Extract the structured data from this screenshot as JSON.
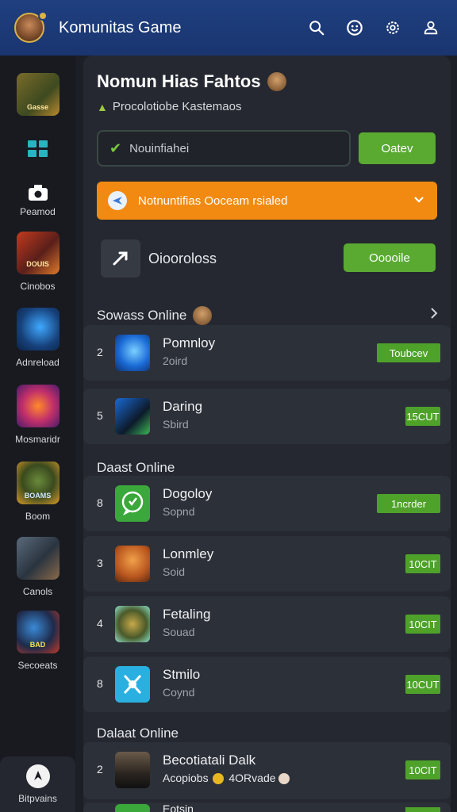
{
  "header": {
    "title": "Komunitas Game",
    "icons": [
      "search-icon",
      "emoji-icon",
      "settings-gear-icon",
      "profile-icon"
    ]
  },
  "sidebar": {
    "items": [
      {
        "label": "",
        "thumb_text": "Gasse",
        "icon": "game-thumb"
      },
      {
        "label": "",
        "icon": "grid-icon"
      },
      {
        "label": "Peamod",
        "icon": "camera-icon"
      },
      {
        "label": "Cinobos",
        "thumb_text": "DOUIS",
        "icon": "game-thumb"
      },
      {
        "label": "Adnreload",
        "icon": "game-thumb"
      },
      {
        "label": "Mosmaridr",
        "icon": "game-thumb"
      },
      {
        "label": "Boom",
        "thumb_text": "BOAMS",
        "icon": "game-thumb"
      },
      {
        "label": "Canols",
        "icon": "game-thumb"
      },
      {
        "label": "Secoeats",
        "thumb_text": "BAD",
        "icon": "game-thumb"
      }
    ],
    "bottom_label": "Bitpvains"
  },
  "main": {
    "title": "Nomun Hias Fahtos",
    "subtitle": "Procolotiobe Kastemaos",
    "search": {
      "value": "Nouinfiahei"
    },
    "search_button": "Oatev",
    "banner": "Notnuntifias Ooceam rsialed",
    "tool": {
      "label": "Oiooroloss",
      "button": "Ooooile"
    },
    "sections": [
      {
        "title": "Sowass Online",
        "rows": [
          {
            "rank": "2",
            "name": "Pomnloy",
            "sub": "2oird",
            "button": "Toubcev"
          },
          {
            "rank": "5",
            "name": "Daring",
            "sub": "Sbird",
            "button": "15CUT"
          }
        ]
      },
      {
        "title": "Daast Online",
        "rows": [
          {
            "rank": "8",
            "name": "Dogoloy",
            "sub": "Sopnd",
            "button": "1ncrder"
          },
          {
            "rank": "3",
            "name": "Lonmley",
            "sub": "Soid",
            "button": "10CIT"
          },
          {
            "rank": "4",
            "name": "Fetaling",
            "sub": "Souad",
            "button": "10CIT"
          },
          {
            "rank": "8",
            "name": "Stmilo",
            "sub": "Coynd",
            "button": "10CUT"
          }
        ]
      },
      {
        "title": "Dalaat Online",
        "rows": [
          {
            "rank": "2",
            "name": "Becotiatali Dalk",
            "sub": "Acopiobs",
            "sub_extra": "4ORvade",
            "button": "10CIT"
          },
          {
            "rank": "",
            "name": "Eotsin",
            "sub": "",
            "button": ""
          }
        ]
      }
    ]
  }
}
